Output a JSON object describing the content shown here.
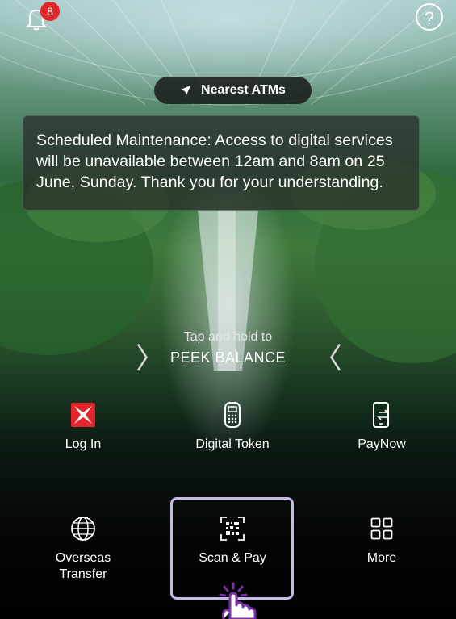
{
  "header": {
    "notification_count": "8",
    "help_symbol": "?"
  },
  "nearest_atms": {
    "label": "Nearest ATMs"
  },
  "notice": {
    "text": "Scheduled Maintenance: Access to digital services will be unavailable between 12am and 8am on 25 June, Sunday. Thank you for your understanding."
  },
  "peek_balance": {
    "hint": "Tap and hold to",
    "label": "PEEK BALANCE"
  },
  "actions": {
    "login": "Log In",
    "digital_token": "Digital Token",
    "paynow": "PayNow",
    "overseas_transfer_line1": "Overseas",
    "overseas_transfer_line2": "Transfer",
    "scan_pay": "Scan & Pay",
    "more": "More"
  },
  "colors": {
    "badge": "#e3262b",
    "brand_red": "#e3262b",
    "highlight": "#c9b9ea",
    "pointer": "#7b2fa8"
  },
  "icons": [
    "bell-icon",
    "help-icon",
    "location-arrow-icon",
    "chevron-right-icon",
    "chevron-left-icon",
    "dbs-logo-icon",
    "token-device-icon",
    "phone-transfer-icon",
    "globe-icon",
    "qr-scan-icon",
    "grid-icon",
    "tap-hand-icon"
  ]
}
